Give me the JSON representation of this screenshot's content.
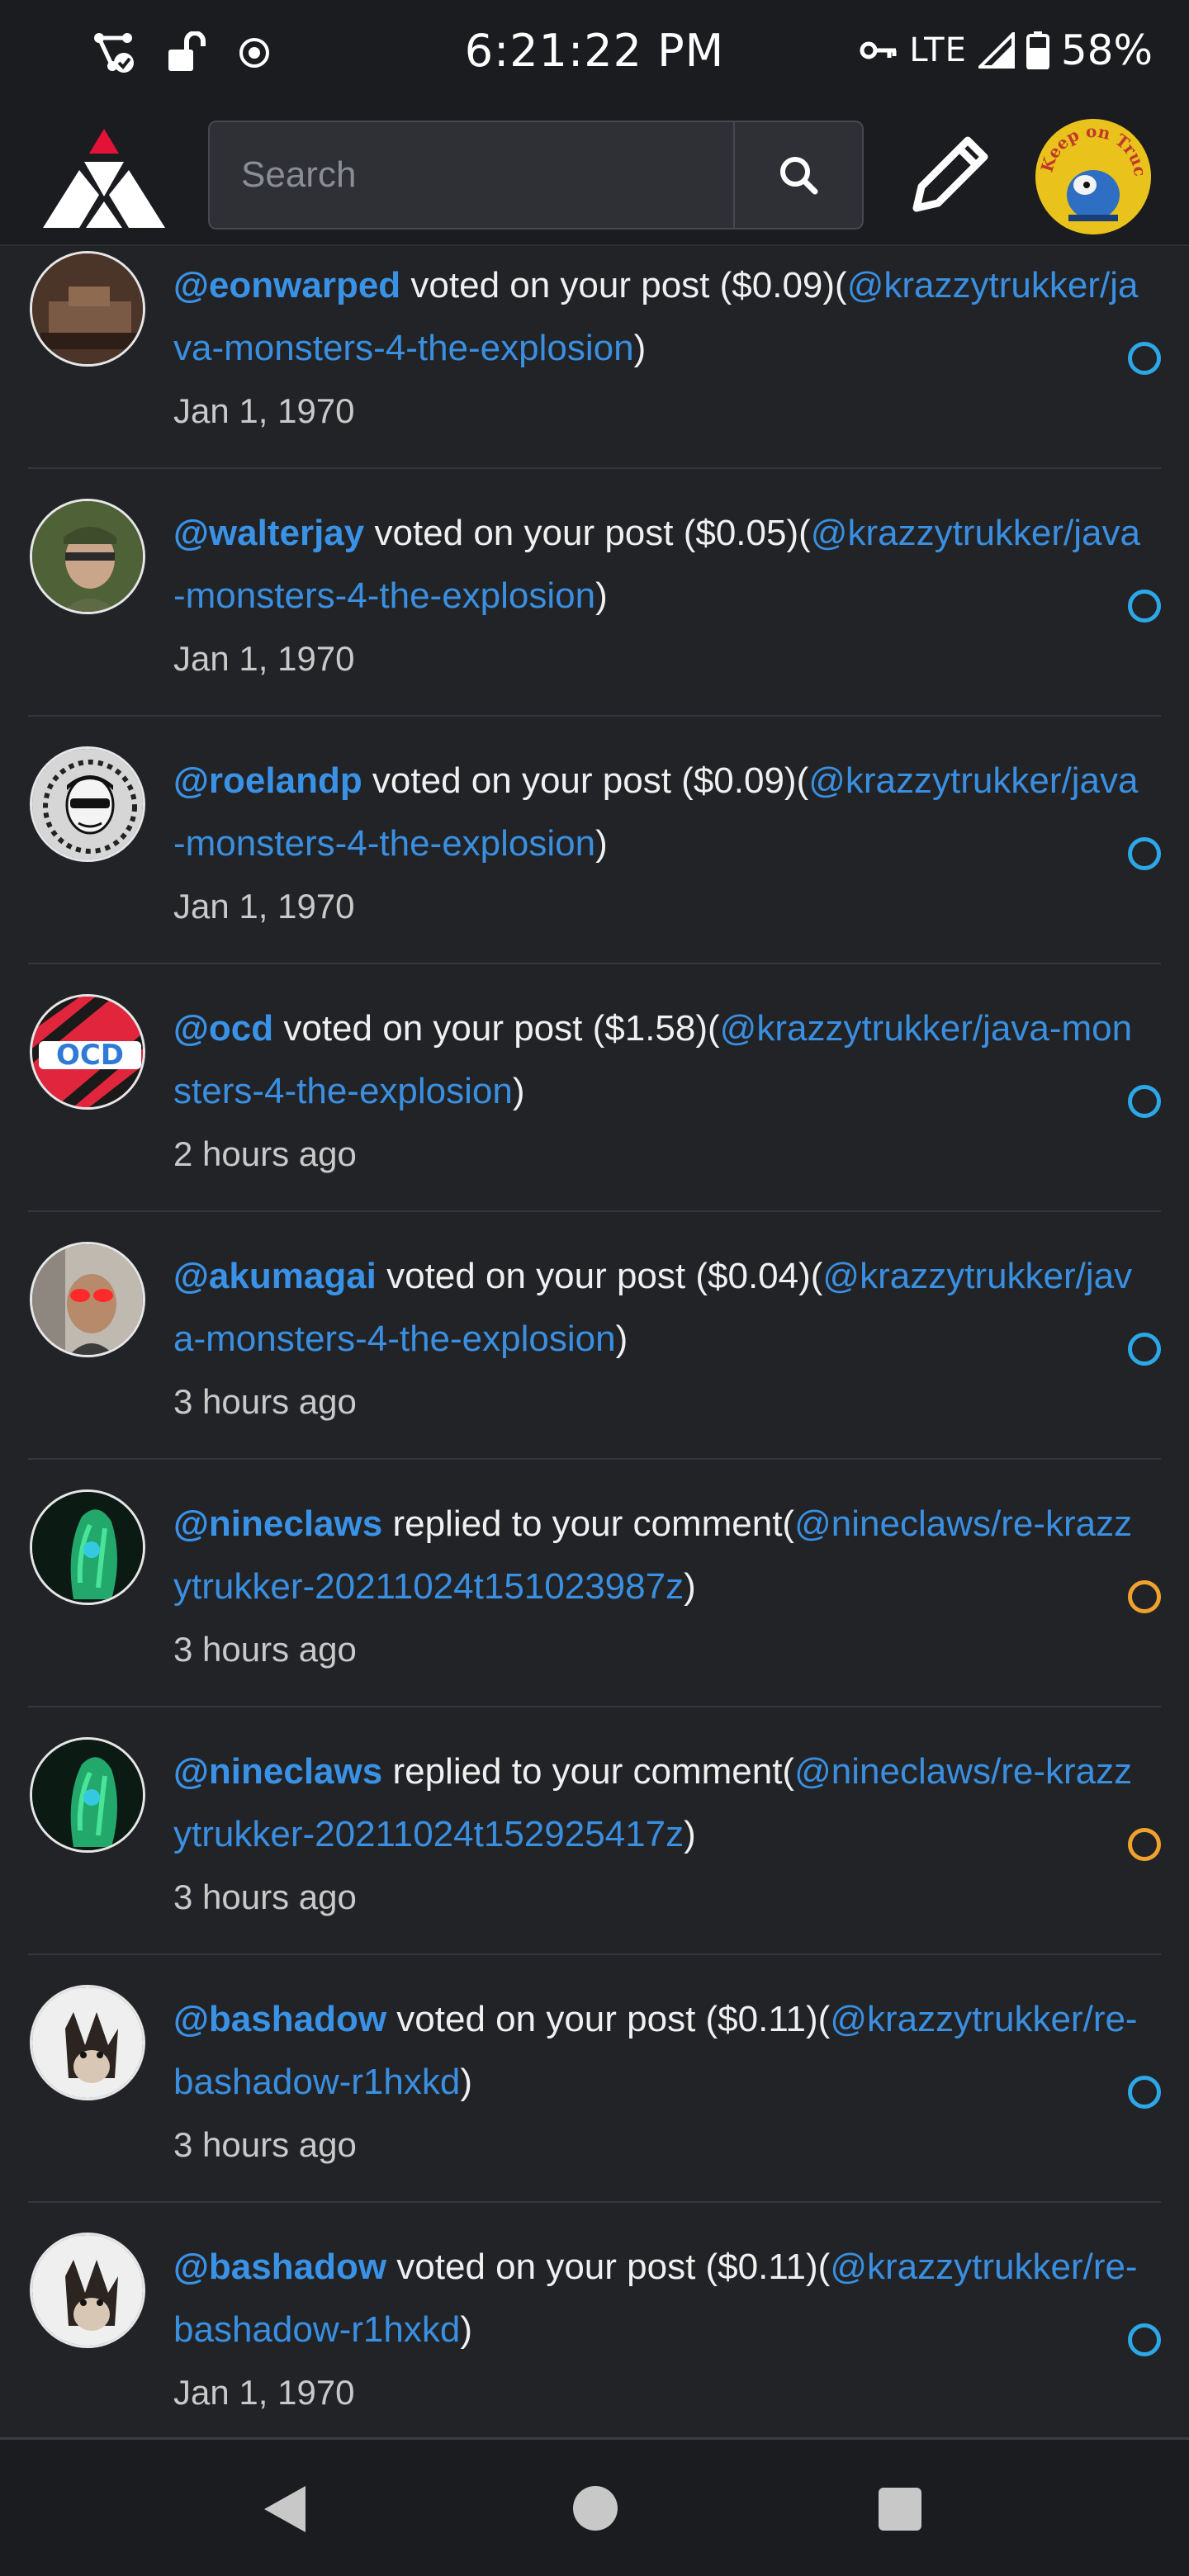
{
  "status_bar": {
    "time": "6:21:22 PM",
    "network": "LTE",
    "battery": "58%"
  },
  "header": {
    "search_placeholder": "Search",
    "logo_icon": "hive-logo-icon",
    "search_icon": "search-icon",
    "compose_icon": "pencil-icon",
    "avatar_text": "Keep on Truckin"
  },
  "notifications": [
    {
      "user": "@eonwarped",
      "action": " voted on your post ($0.09)(",
      "link": "@krazzytrukker/java-monsters-4-the-explosion",
      "close": ")",
      "time": "Jan 1, 1970",
      "kind": "vote"
    },
    {
      "user": "@walterjay",
      "action": " voted on your post ($0.05)(",
      "link": "@krazzytrukker/java-monsters-4-the-explosion",
      "close": ")",
      "time": "Jan 1, 1970",
      "kind": "vote"
    },
    {
      "user": "@roelandp",
      "action": " voted on your post ($0.09)(",
      "link": "@krazzytrukker/java-monsters-4-the-explosion",
      "close": ")",
      "time": "Jan 1, 1970",
      "kind": "vote"
    },
    {
      "user": "@ocd",
      "action": " voted on your post ($1.58)(",
      "link": "@krazzytrukker/java-monsters-4-the-explosion",
      "close": ")",
      "time": "2 hours ago",
      "kind": "vote"
    },
    {
      "user": "@akumagai",
      "action": " voted on your post ($0.04)(",
      "link": "@krazzytrukker/java-monsters-4-the-explosion",
      "close": ")",
      "time": "3 hours ago",
      "kind": "vote"
    },
    {
      "user": "@nineclaws",
      "action": " replied to your comment(",
      "link": "@nineclaws/re-krazzytrukker-20211024t151023987z",
      "close": ")",
      "time": "3 hours ago",
      "kind": "reply"
    },
    {
      "user": "@nineclaws",
      "action": " replied to your comment(",
      "link": "@nineclaws/re-krazzytrukker-20211024t152925417z",
      "close": ")",
      "time": "3 hours ago",
      "kind": "reply"
    },
    {
      "user": "@bashadow",
      "action": " voted on your post ($0.11)(",
      "link": "@krazzytrukker/re-bashadow-r1hxkd",
      "close": ")",
      "time": "3 hours ago",
      "kind": "vote"
    },
    {
      "user": "@bashadow",
      "action": " voted on your post ($0.11)(",
      "link": "@krazzytrukker/re-bashadow-r1hxkd",
      "close": ")",
      "time": "Jan 1, 1970",
      "kind": "vote"
    }
  ],
  "colors": {
    "accent": "#3a92e6",
    "vote_dot": "#2da7e6",
    "reply_dot": "#f0a22e",
    "background": "#212327"
  }
}
